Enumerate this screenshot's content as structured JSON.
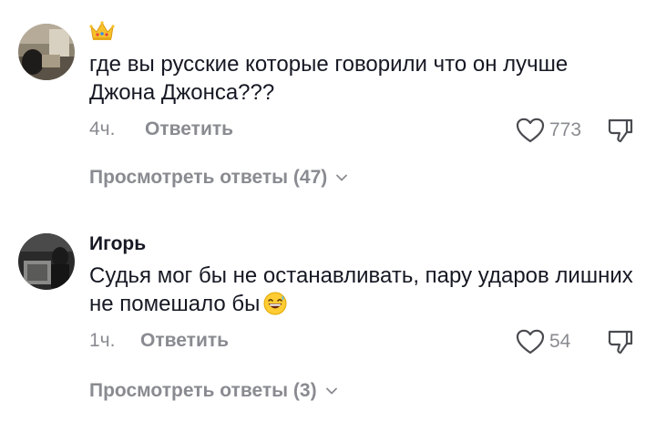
{
  "comments": [
    {
      "author": "",
      "badge": "crown-icon",
      "text": "где вы русские которые говорили что он лучше Джона Джонса???",
      "emoji": "",
      "time": "4ч.",
      "reply_label": "Ответить",
      "likes": "773",
      "view_replies": "Просмотреть ответы (47)"
    },
    {
      "author": "Игорь",
      "badge": "",
      "text": "Судья мог бы не останавливать, пару ударов лишних не помешало бы",
      "emoji": "grinning-sweat-emoji",
      "time": "1ч.",
      "reply_label": "Ответить",
      "likes": "54",
      "view_replies": "Просмотреть ответы (3)"
    }
  ],
  "colors": {
    "text_primary": "#161823",
    "text_secondary": "#8a8b91",
    "background": "#ffffff"
  }
}
